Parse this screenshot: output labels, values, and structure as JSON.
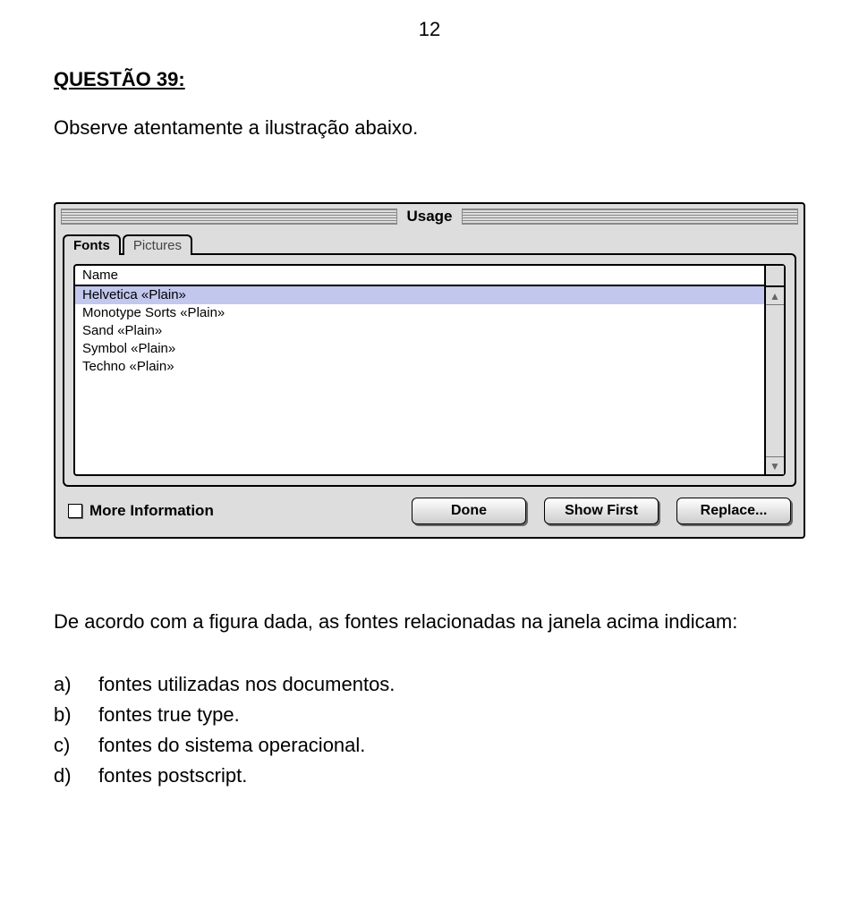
{
  "page_number": "12",
  "question": {
    "heading": "QUESTÃO 39:",
    "intro": "Observe atentamente a ilustração abaixo.",
    "prompt": "De acordo com a figura dada, as fontes relacionadas na janela acima indicam:",
    "options": {
      "a": {
        "letter": "a)",
        "text": "fontes utilizadas nos documentos."
      },
      "b": {
        "letter": "b)",
        "text": "fontes true type."
      },
      "c": {
        "letter": "c)",
        "text": "fontes do sistema operacional."
      },
      "d": {
        "letter": "d)",
        "text": "fontes postscript."
      }
    }
  },
  "dialog": {
    "title": "Usage",
    "tabs": {
      "fonts": "Fonts",
      "pictures": "Pictures"
    },
    "list": {
      "header": "Name",
      "rows": [
        "Helvetica «Plain»",
        "Monotype Sorts «Plain»",
        "Sand «Plain»",
        "Symbol «Plain»",
        "Techno «Plain»"
      ],
      "selected_index": 0
    },
    "checkbox_label": "More Information",
    "buttons": {
      "done": "Done",
      "show_first": "Show First",
      "replace": "Replace..."
    }
  }
}
